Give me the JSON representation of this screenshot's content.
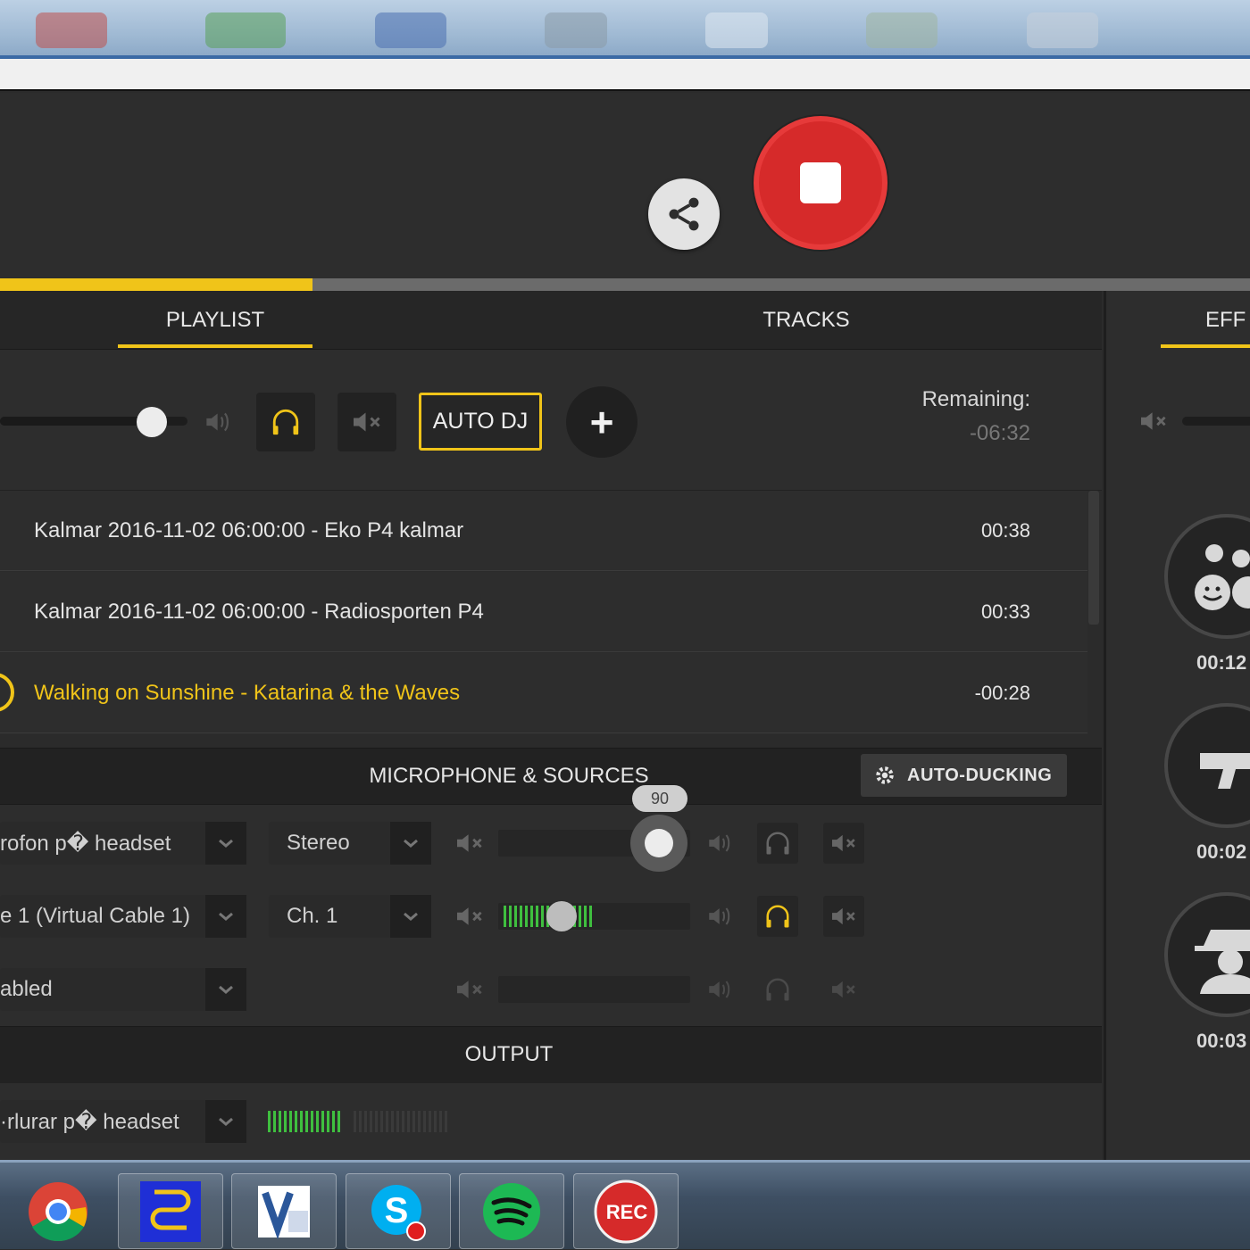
{
  "colors": {
    "accent": "#f0c419",
    "record": "#d62a2a",
    "panel": "#2d2d2d"
  },
  "progress": {
    "fraction": 0.25
  },
  "tabs": [
    {
      "label": "PLAYLIST",
      "active": true
    },
    {
      "label": "TRACKS",
      "active": false
    },
    {
      "label": "EFF",
      "active": true
    }
  ],
  "playlist": {
    "volume_fraction": 0.85,
    "auto_dj_label": "AUTO DJ",
    "add_label": "+",
    "remaining_label": "Remaining:",
    "remaining_value": "-06:32",
    "rows": [
      {
        "title": "Kalmar 2016-11-02 06:00:00 - Eko P4 kalmar",
        "duration": "00:38"
      },
      {
        "title": "Kalmar 2016-11-02 06:00:00 - Radiosporten P4",
        "duration": "00:33"
      },
      {
        "title": "Walking on Sunshine - Katarina & the Waves",
        "duration": "-00:28",
        "playing": true
      }
    ]
  },
  "microphone": {
    "title": "MICROPHONE & SOURCES",
    "auto_ducking_label": "AUTO-DUCKING",
    "volume_badge": "90",
    "sources": [
      {
        "device": "rofon p� headset",
        "channel": "Stereo",
        "level_fraction": 0.85,
        "monitor_active": false
      },
      {
        "device": "e 1 (Virtual Cable 1)",
        "channel": "Ch. 1",
        "level_fraction": 0.33,
        "monitor_active": true
      },
      {
        "device": "abled",
        "channel": "",
        "level_fraction": 0,
        "monitor_active": false
      }
    ]
  },
  "output": {
    "title": "OUTPUT",
    "device": "·rlurar p� headset",
    "meter_fraction": 0.42
  },
  "effects": {
    "times": [
      "00:12",
      "00:02",
      "00:03"
    ],
    "icons": [
      "crowd-faces-icon",
      "gun-icon",
      "spy-icon"
    ]
  },
  "taskbar": {
    "apps": [
      "chrome-icon",
      "cable-app-icon",
      "visio-icon",
      "skype-icon",
      "spotify-icon",
      "rec-app-icon"
    ],
    "rec_label": "REC"
  }
}
